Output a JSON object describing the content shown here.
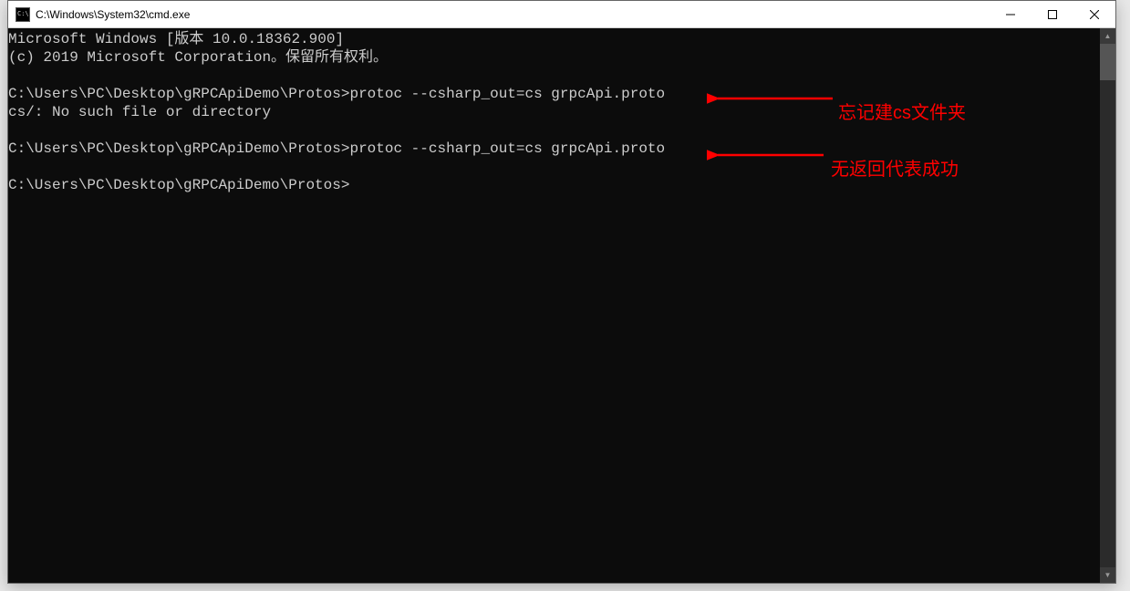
{
  "window": {
    "title": "C:\\Windows\\System32\\cmd.exe"
  },
  "console": {
    "header_line": "Microsoft Windows [版本 10.0.18362.900]",
    "copyright_line": "(c) 2019 Microsoft Corporation。保留所有权利。",
    "prompt": "C:\\Users\\PC\\Desktop\\gRPCApiDemo\\Protos>",
    "cmd1": "protoc --csharp_out=cs grpcApi.proto",
    "err1": "cs/: No such file or directory",
    "cmd2": "protoc --csharp_out=cs grpcApi.proto"
  },
  "annotations": {
    "note1": "忘记建cs文件夹",
    "note2": "无返回代表成功"
  }
}
